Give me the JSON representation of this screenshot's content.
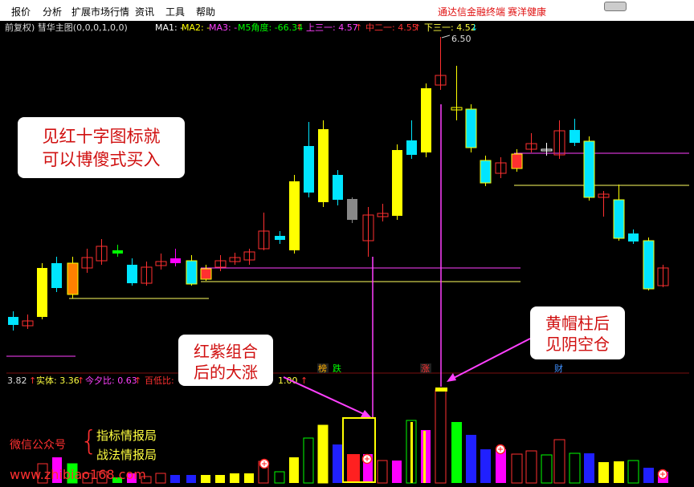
{
  "menu": {
    "items": [
      "报价",
      "分析",
      "扩展市场行情",
      "资讯",
      "工具",
      "帮助"
    ],
    "brand_left": "通达信金融终端",
    "brand_right": "赛洋健康"
  },
  "indicator_bar": {
    "title": "前复权) 彗华主图(0,0,0,1,0,0)",
    "ma1": "MA1: -",
    "ma2": "MA2: -",
    "ma3": "MA3: -",
    "m5": "M5角度: -66.34",
    "arrow_up": "↑",
    "arrow_down": "↓",
    "up3": "上三一: 4.57",
    "mid2": "中二一: 4.55",
    "down3": "下三一: 4.52"
  },
  "price_label_high": "6.50",
  "sub_indicator": {
    "v1": "3.82",
    "entity": "实体: 3.36",
    "today_ratio": "今夕比: 0.63",
    "low_ratio": "百低比:",
    "tail": "1.00"
  },
  "tags": {
    "bang": "榜",
    "yue": "跌",
    "zhang": "涨",
    "cai": "财"
  },
  "callouts": {
    "left": [
      "见红十字图标就",
      "可以博傻式买入"
    ],
    "mid": [
      "红紫组合",
      "后的大涨"
    ],
    "right": [
      "黄帽柱后",
      "见阴空仓"
    ]
  },
  "wechat": {
    "label": "微信公众号",
    "brace": "{",
    "line1": "指标情报局",
    "line2": "战法情报局"
  },
  "watermark": "www.zhibiao168.com",
  "colors": {
    "up_red": "#ff2020",
    "down_cyan": "#00e5ff",
    "yellow": "#ffff00",
    "magenta": "#ff00ff",
    "green": "#00ff00",
    "blue": "#2020ff"
  }
}
